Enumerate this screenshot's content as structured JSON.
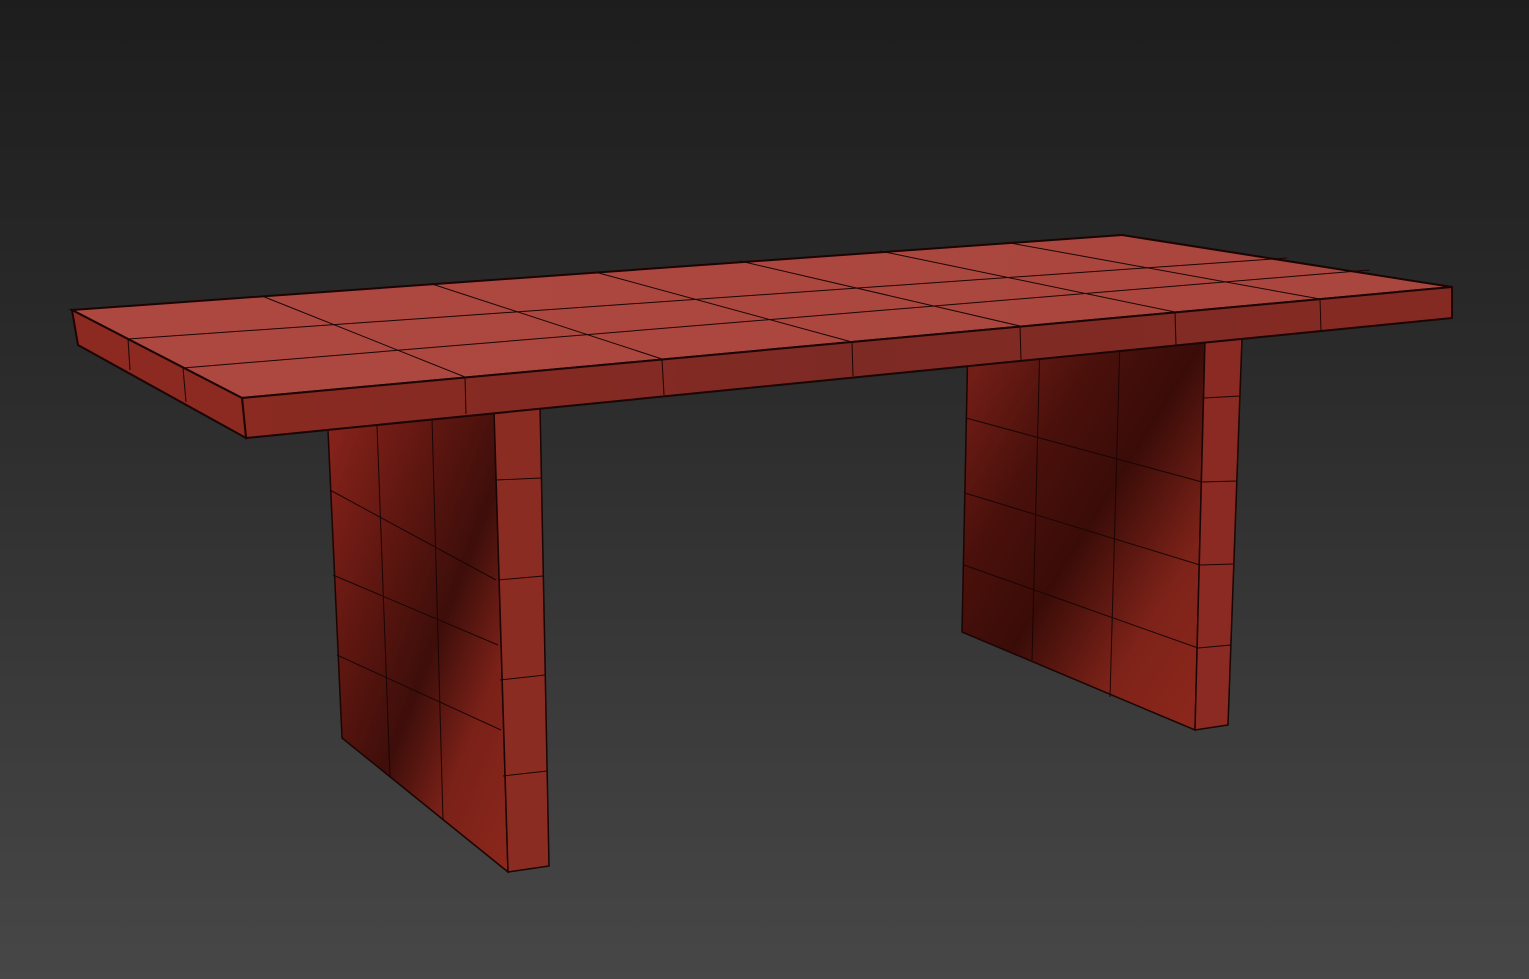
{
  "viewport": {
    "background_top": "#1d1d1d",
    "background_bottom": "#474747"
  },
  "model": {
    "object": "table",
    "material_color": "#a8453c",
    "wire_color": "#1a0504",
    "parts": [
      "tabletop",
      "left-leg",
      "right-leg"
    ]
  }
}
